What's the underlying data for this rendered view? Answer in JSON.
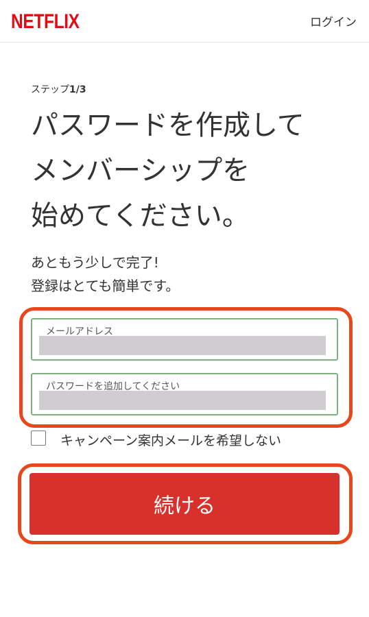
{
  "header": {
    "logo_text": "NETFLIX",
    "login_label": "ログイン"
  },
  "step": {
    "prefix": "ステップ",
    "count": "1/3"
  },
  "title_lines": [
    "パスワードを作成して",
    "メンバーシップを",
    "始めてください。"
  ],
  "subtitle_lines": [
    "あともう少しで完了!",
    "登録はとても簡単です。"
  ],
  "form": {
    "email_label": "メールアドレス",
    "email_value": "",
    "password_label": "パスワードを追加してください",
    "password_value": "",
    "opt_out_label": "キャンペーン案内メールを希望しない",
    "opt_out_checked": false
  },
  "continue_label": "続ける",
  "colors": {
    "brand_red": "#e50914",
    "button_red": "#d8302b",
    "field_border": "#7db27d",
    "annotation_outline": "#e8461c"
  }
}
